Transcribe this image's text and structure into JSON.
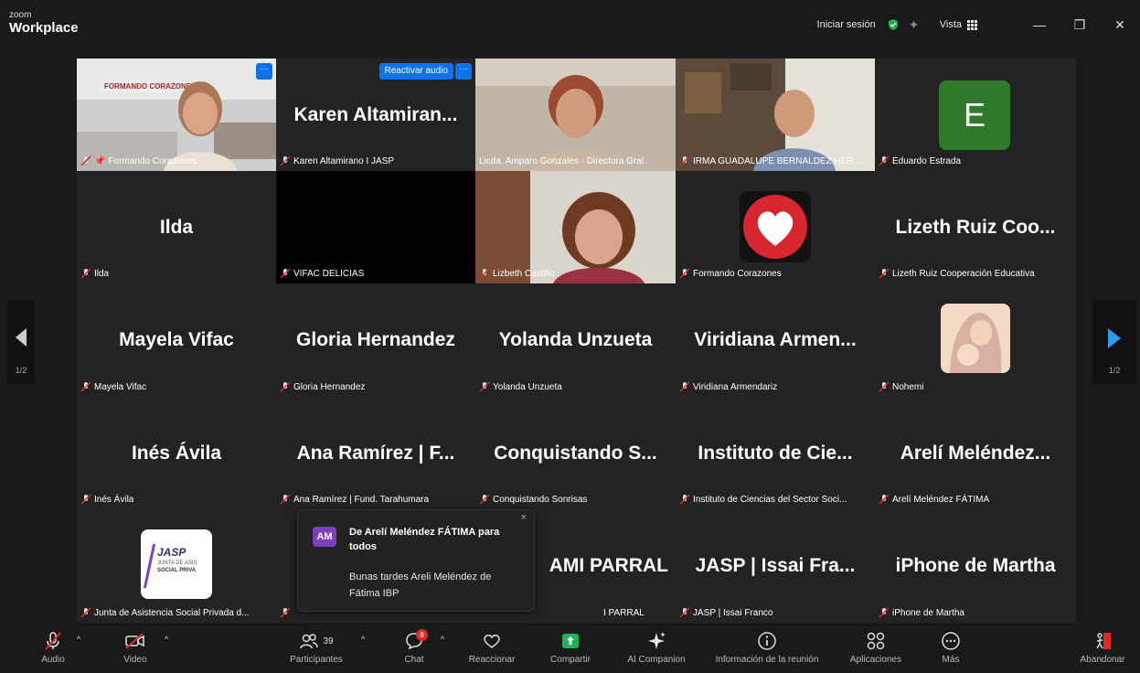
{
  "titlebar": {
    "logo_small": "zoom",
    "logo_big": "Workplace",
    "signin": "Iniciar sesión",
    "view": "Vista"
  },
  "pager": {
    "left": "1/2",
    "right": "1/2"
  },
  "tiles": [
    {
      "label": "Formando Corazones",
      "big": ""
    },
    {
      "label": "Karen Altamirano I JASP",
      "big": "Karen  Altamiran...",
      "reactivar": "Reactivar audio"
    },
    {
      "label": "Licda. Amparo Gonzales - Directora Gral.",
      "big": ""
    },
    {
      "label": "IRMA GUADALUPE BERNALDEZ HER...",
      "big": ""
    },
    {
      "label": "Eduardo Estrada",
      "big": "",
      "initial": "E"
    },
    {
      "label": "Ilda",
      "big": "Ilda"
    },
    {
      "label": "VIFAC DELICIAS",
      "big": ""
    },
    {
      "label": "Lizbeth Castillo",
      "big": ""
    },
    {
      "label": "Formando Corazones",
      "big": ""
    },
    {
      "label": "Lizeth Ruiz Cooperación Educativa",
      "big": "Lizeth  Ruiz  Coo..."
    },
    {
      "label": "Mayela Vifac",
      "big": "Mayela  Vifac"
    },
    {
      "label": "Gloria Hernandez",
      "big": "Gloria  Hernandez"
    },
    {
      "label": "Yolanda Unzueta",
      "big": "Yolanda  Unzueta"
    },
    {
      "label": "Viridiana Armendariz",
      "big": "Viridiana  Armen..."
    },
    {
      "label": "Nohemi",
      "big": ""
    },
    {
      "label": "Inés Ávila",
      "big": "Inés  Ávila"
    },
    {
      "label": "Ana Ramírez | Fund. Tarahumara",
      "big": "Ana  Ramírez  |  F..."
    },
    {
      "label": "Conquistando Sonrisas",
      "big": "Conquistando  S..."
    },
    {
      "label": "Instituto de Ciencias del Sector Soci...",
      "big": "Instituto  de  Cie..."
    },
    {
      "label": "Arelí Meléndez FÁTIMA",
      "big": "Arelí  Meléndez..."
    },
    {
      "label": "Junta de Asistencia Social Privada d...",
      "big": "",
      "logo_lines": [
        "JASP",
        "JUNTA DE ASIS",
        "SOCIAL PRIVA"
      ]
    },
    {
      "label": "",
      "big": ""
    },
    {
      "label": "I PARRAL",
      "big": "AMI  PARRAL"
    },
    {
      "label": "JASP | Issai Franco",
      "big": "JASP  |  Issai  Fra..."
    },
    {
      "label": "iPhone de Martha",
      "big": "iPhone  de  Martha"
    }
  ],
  "chat_popup": {
    "avatar": "AM",
    "title": "De Arelí Meléndez FÁTIMA para todos",
    "message": "Bunas tardes Areli Meléndez de Fátima IBP",
    "close": "×"
  },
  "toolbar": {
    "audio": "Audio",
    "video": "Video",
    "participants": "Participantes",
    "participants_count": "39",
    "chat": "Chat",
    "chat_badge": "8",
    "react": "Reaccionar",
    "share": "Compartir",
    "ai": "AI Companion",
    "info": "Información de la reunión",
    "apps": "Aplicaciones",
    "more": "Más",
    "leave": "Abandonar"
  },
  "colors": {
    "accent_blue": "#0e72ed",
    "active_green": "#3fd18b",
    "share_green": "#1fb45a",
    "muted_red": "#e02828",
    "tile_bg": "#232323"
  }
}
